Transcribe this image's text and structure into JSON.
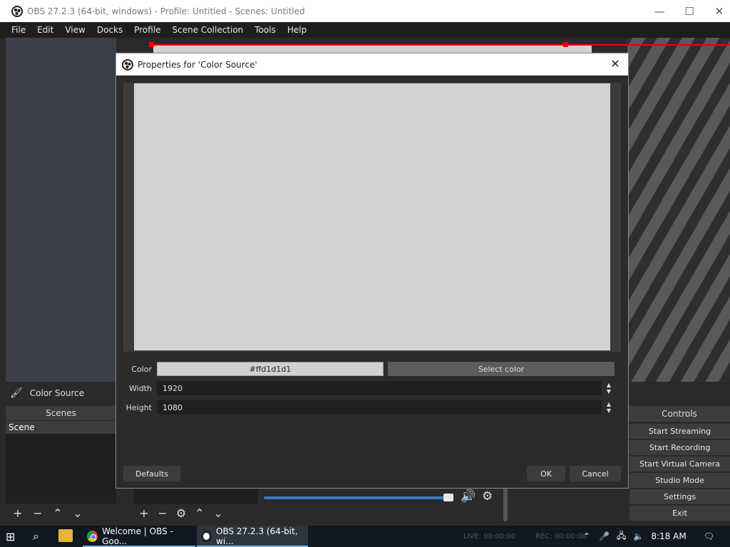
{
  "window": {
    "title": "OBS 27.2.3 (64-bit, windows) - Profile: Untitled - Scenes: Untitled",
    "minimize": "—",
    "maximize": "☐",
    "close": "✕"
  },
  "menu": [
    "File",
    "Edit",
    "View",
    "Docks",
    "Profile",
    "Scene Collection",
    "Tools",
    "Help"
  ],
  "source_bar": {
    "label": "Color Source"
  },
  "scenes": {
    "title": "Scenes",
    "items": [
      "Scene"
    ]
  },
  "controls": {
    "title": "Controls",
    "buttons": [
      "Start Streaming",
      "Start Recording",
      "Start Virtual Camera",
      "Studio Mode",
      "Settings",
      "Exit"
    ]
  },
  "dialog": {
    "title": "Properties for 'Color Source'",
    "color_label": "Color",
    "color_value": "#ffd1d1d1",
    "select_color": "Select color",
    "width_label": "Width",
    "width_value": "1920",
    "height_label": "Height",
    "height_value": "1080",
    "defaults": "Defaults",
    "ok": "OK",
    "cancel": "Cancel",
    "preview_color": "#d1d1d1"
  },
  "taskbar": {
    "items": [
      {
        "label": "Welcome | OBS - Goo...",
        "icon": "chrome-icon"
      },
      {
        "label": "OBS 27.2.3 (64-bit, wi...",
        "icon": "obs-icon"
      }
    ],
    "status_live": "LIVE: 00:00:00",
    "status_rec": "REC: 00:00:00",
    "time": "8:18 AM"
  },
  "colors": {
    "accent": "#e00000",
    "volume": "#3a78c4",
    "taskbar": "#101820"
  }
}
